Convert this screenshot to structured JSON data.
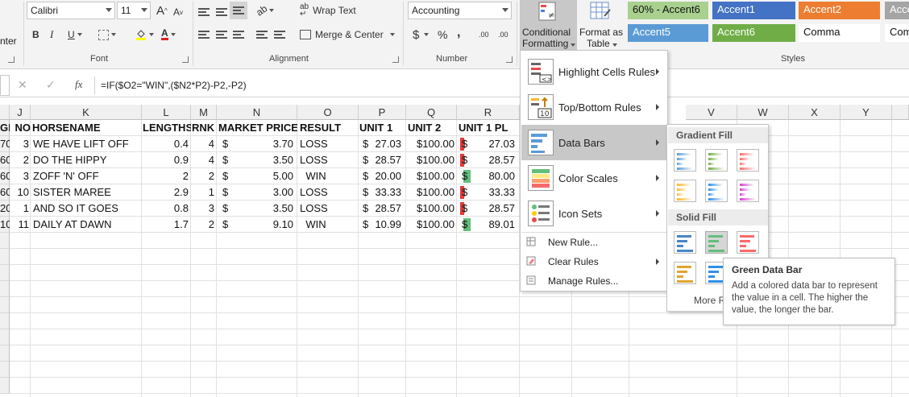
{
  "ribbon": {
    "clip_label": "nter",
    "font": {
      "name": "Calibri",
      "size": "11",
      "grow_label": "A",
      "shrink_label": "A",
      "bold": "B",
      "italic": "I",
      "underline": "U",
      "font_color_letter": "A",
      "group_label": "Font"
    },
    "alignment": {
      "wrap_text": "Wrap Text",
      "merge_center": "Merge & Center",
      "group_label": "Alignment"
    },
    "number": {
      "format": "Accounting",
      "currency": "$",
      "percent": "%",
      "comma": ",",
      "inc_decimal": ".00",
      "dec_decimal": ".00",
      "group_label": "Number"
    },
    "conditional_formatting": {
      "line1": "Conditional",
      "line2": "Formatting"
    },
    "format_as_table": {
      "line1": "Format as",
      "line2": "Table"
    },
    "styles": {
      "group_label": "Styles",
      "cells": [
        {
          "label": "60% - Accent6",
          "bg": "#a9d08e",
          "fg": "#111111"
        },
        {
          "label": "Accent1",
          "bg": "#4472c4",
          "fg": "#ffffff"
        },
        {
          "label": "Accent2",
          "bg": "#ed7d31",
          "fg": "#ffffff"
        },
        {
          "label": "Acce",
          "bg": "#a5a5a5",
          "fg": "#ffffff"
        },
        {
          "label": "Accent5",
          "bg": "#5b9bd5",
          "fg": "#ffffff"
        },
        {
          "label": "Accent6",
          "bg": "#70ad47",
          "fg": "#ffffff"
        },
        {
          "label": "Comma",
          "bg": "#ffffff",
          "fg": "#111111"
        },
        {
          "label": "Com",
          "bg": "#ffffff",
          "fg": "#111111"
        }
      ]
    }
  },
  "formula_bar": {
    "cancel": "✕",
    "enter": "✓",
    "fx": "fx",
    "formula": "=IF($O2=\"WIN\",($N2*P2)-P2,-P2)"
  },
  "sheet": {
    "columns": [
      "J",
      "K",
      "L",
      "M",
      "N",
      "O",
      "P",
      "Q",
      "R",
      "V",
      "W",
      "X",
      "Y"
    ],
    "header_row": [
      "GE",
      "NO",
      "HORSENAME",
      "LENGTHS",
      "RNK",
      "MARKET PRICE",
      "RESULT",
      "UNIT 1",
      "UNIT 2",
      "UNIT 1 PL"
    ],
    "rows": [
      {
        "ge": "70",
        "no": "3",
        "horse": "WE HAVE LIFT OFF",
        "lengths": "0.4",
        "rnk": "4",
        "price": "3.70",
        "result": "LOSS",
        "unit1": "27.03",
        "unit2": "$100.00",
        "pl": "27.03",
        "pl_positive": false
      },
      {
        "ge": "60",
        "no": "2",
        "horse": "DO THE HIPPY",
        "lengths": "0.9",
        "rnk": "4",
        "price": "3.50",
        "result": "LOSS",
        "unit1": "28.57",
        "unit2": "$100.00",
        "pl": "28.57",
        "pl_positive": false
      },
      {
        "ge": "60",
        "no": "3",
        "horse": "ZOFF 'N' OFF",
        "lengths": "2",
        "rnk": "2",
        "price": "5.00",
        "result": "WIN",
        "unit1": "20.00",
        "unit2": "$100.00",
        "pl": "80.00",
        "pl_positive": true
      },
      {
        "ge": "60",
        "no": "10",
        "horse": "SISTER MAREE",
        "lengths": "2.9",
        "rnk": "1",
        "price": "3.00",
        "result": "LOSS",
        "unit1": "33.33",
        "unit2": "$100.00",
        "pl": "33.33",
        "pl_positive": false
      },
      {
        "ge": "20",
        "no": "1",
        "horse": "AND SO IT GOES",
        "lengths": "0.8",
        "rnk": "3",
        "price": "3.50",
        "result": "LOSS",
        "unit1": "28.57",
        "unit2": "$100.00",
        "pl": "28.57",
        "pl_positive": false
      },
      {
        "ge": "10",
        "no": "11",
        "horse": "DAILY AT DAWN",
        "lengths": "1.7",
        "rnk": "2",
        "price": "9.10",
        "result": "WIN",
        "unit1": "10.99",
        "unit2": "$100.00",
        "pl": "89.01",
        "pl_positive": true
      }
    ],
    "currency_symbol": "$"
  },
  "cf_menu": {
    "items": [
      {
        "label": "Highlight Cells Rules",
        "icon": "highlight-cells-icon"
      },
      {
        "label": "Top/Bottom Rules",
        "icon": "top-bottom-icon",
        "icon_text": "10"
      },
      {
        "label": "Data Bars",
        "icon": "data-bars-icon"
      },
      {
        "label": "Color Scales",
        "icon": "color-scales-icon"
      },
      {
        "label": "Icon Sets",
        "icon": "icon-sets-icon"
      }
    ],
    "small_items": [
      {
        "label": "New Rule...",
        "icon": "new-rule-icon"
      },
      {
        "label": "Clear Rules",
        "icon": "clear-rules-icon"
      },
      {
        "label": "Manage Rules...",
        "icon": "manage-rules-icon"
      }
    ]
  },
  "data_bars_menu": {
    "gradient_label": "Gradient Fill",
    "solid_label": "Solid Fill",
    "more_label": "More R",
    "gradient_colors": [
      "#5b9bd5",
      "#70ad47",
      "#ff6b6b",
      "#ffb628",
      "#2f8fe8",
      "#d63fd0"
    ],
    "solid_colors": [
      "#4a86c8",
      "#63be7b",
      "#f8696b",
      "#e0a530",
      "#2f8fe8"
    ]
  },
  "tooltip": {
    "title": "Green Data Bar",
    "body": "Add a colored data bar to represent the value in a cell. The higher the value, the longer the bar."
  },
  "colors": {
    "loss_bar": "#e33b3b",
    "win_bar": "#63be7b",
    "menu_highlight": "#c8c8c8",
    "ribbon_bg": "#f3f3f3"
  }
}
